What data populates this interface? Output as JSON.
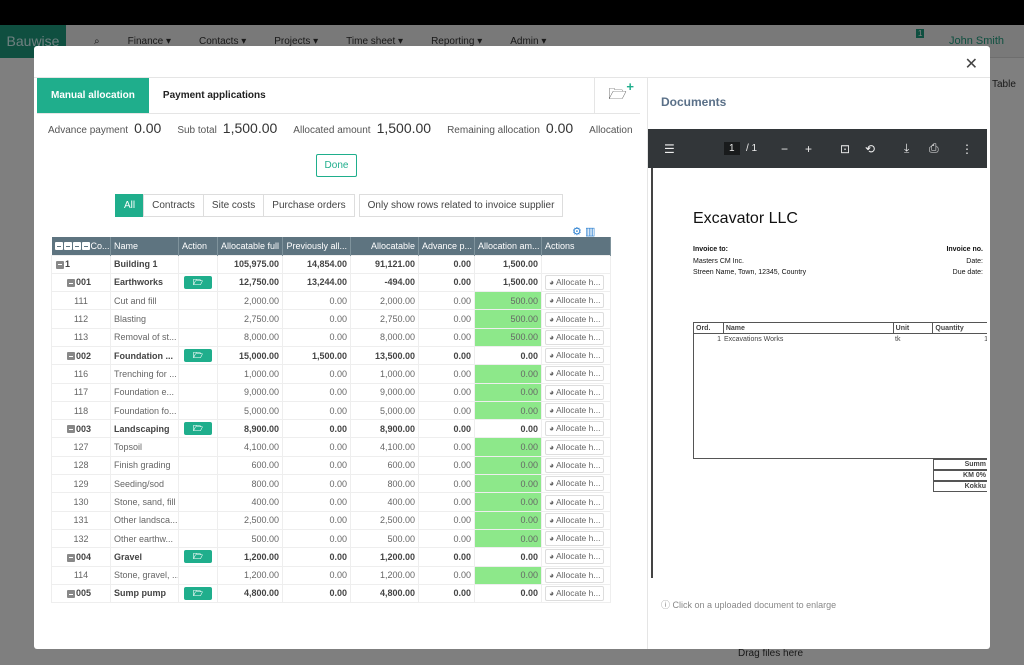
{
  "background": {
    "brand": "Bauwise",
    "nav": [
      "Finance ▾",
      "Contacts ▾",
      "Projects ▾",
      "Time sheet ▾",
      "Reporting ▾",
      "Admin ▾"
    ],
    "user": "John Smith",
    "notification_count": "1",
    "table_link": "Table",
    "drag_files": "Drag files here"
  },
  "modal": {
    "tabs": [
      "Manual allocation",
      "Payment applications"
    ],
    "summary": {
      "advance_label": "Advance payment",
      "advance": "0.00",
      "subtotal_label": "Sub total",
      "subtotal": "1,500.00",
      "allocated_label": "Allocated amount",
      "allocated": "1,500.00",
      "remaining_label": "Remaining allocation",
      "remaining": "0.00",
      "allocation_label": "Allocation"
    },
    "done": "Done",
    "filters": [
      "All",
      "Contracts",
      "Site costs",
      "Purchase orders"
    ],
    "supplier_filter": "Only show rows related to invoice supplier",
    "columns": [
      "Co...",
      "Name",
      "Action",
      "Allocatable full",
      "Previously all...",
      "Allocatable",
      "Advance p...",
      "Allocation am...",
      "Actions"
    ],
    "allocate_label": "Allocate h...",
    "rows": [
      {
        "code": "1",
        "name": "Building 1",
        "level": 0,
        "full": "105,975.00",
        "prev": "14,854.00",
        "alloc": "91,121.00",
        "adv": "0.00",
        "amt": "1,500.00"
      },
      {
        "code": "001",
        "name": "Earthworks",
        "level": 1,
        "full": "12,750.00",
        "prev": "13,244.00",
        "alloc": "-494.00",
        "adv": "0.00",
        "amt": "1,500.00"
      },
      {
        "code": "111",
        "name": "Cut and fill",
        "level": 2,
        "full": "2,000.00",
        "prev": "0.00",
        "alloc": "2,000.00",
        "adv": "0.00",
        "amt": "500.00"
      },
      {
        "code": "112",
        "name": "Blasting",
        "level": 2,
        "full": "2,750.00",
        "prev": "0.00",
        "alloc": "2,750.00",
        "adv": "0.00",
        "amt": "500.00"
      },
      {
        "code": "113",
        "name": "Removal of st...",
        "level": 2,
        "full": "8,000.00",
        "prev": "0.00",
        "alloc": "8,000.00",
        "adv": "0.00",
        "amt": "500.00"
      },
      {
        "code": "002",
        "name": "Foundation ...",
        "level": 1,
        "full": "15,000.00",
        "prev": "1,500.00",
        "alloc": "13,500.00",
        "adv": "0.00",
        "amt": "0.00"
      },
      {
        "code": "116",
        "name": "Trenching for ...",
        "level": 2,
        "full": "1,000.00",
        "prev": "0.00",
        "alloc": "1,000.00",
        "adv": "0.00",
        "amt": "0.00"
      },
      {
        "code": "117",
        "name": "Foundation e...",
        "level": 2,
        "full": "9,000.00",
        "prev": "0.00",
        "alloc": "9,000.00",
        "adv": "0.00",
        "amt": "0.00"
      },
      {
        "code": "118",
        "name": "Foundation fo...",
        "level": 2,
        "full": "5,000.00",
        "prev": "0.00",
        "alloc": "5,000.00",
        "adv": "0.00",
        "amt": "0.00"
      },
      {
        "code": "003",
        "name": "Landscaping",
        "level": 1,
        "full": "8,900.00",
        "prev": "0.00",
        "alloc": "8,900.00",
        "adv": "0.00",
        "amt": "0.00"
      },
      {
        "code": "127",
        "name": "Topsoil",
        "level": 2,
        "full": "4,100.00",
        "prev": "0.00",
        "alloc": "4,100.00",
        "adv": "0.00",
        "amt": "0.00"
      },
      {
        "code": "128",
        "name": "Finish grading",
        "level": 2,
        "full": "600.00",
        "prev": "0.00",
        "alloc": "600.00",
        "adv": "0.00",
        "amt": "0.00"
      },
      {
        "code": "129",
        "name": "Seeding/sod",
        "level": 2,
        "full": "800.00",
        "prev": "0.00",
        "alloc": "800.00",
        "adv": "0.00",
        "amt": "0.00"
      },
      {
        "code": "130",
        "name": "Stone, sand, fill",
        "level": 2,
        "full": "400.00",
        "prev": "0.00",
        "alloc": "400.00",
        "adv": "0.00",
        "amt": "0.00"
      },
      {
        "code": "131",
        "name": "Other landsca...",
        "level": 2,
        "full": "2,500.00",
        "prev": "0.00",
        "alloc": "2,500.00",
        "adv": "0.00",
        "amt": "0.00"
      },
      {
        "code": "132",
        "name": "Other earthw...",
        "level": 2,
        "full": "500.00",
        "prev": "0.00",
        "alloc": "500.00",
        "adv": "0.00",
        "amt": "0.00"
      },
      {
        "code": "004",
        "name": "Gravel",
        "level": 1,
        "full": "1,200.00",
        "prev": "0.00",
        "alloc": "1,200.00",
        "adv": "0.00",
        "amt": "0.00"
      },
      {
        "code": "114",
        "name": "Stone, gravel, ...",
        "level": 2,
        "full": "1,200.00",
        "prev": "0.00",
        "alloc": "1,200.00",
        "adv": "0.00",
        "amt": "0.00"
      },
      {
        "code": "005",
        "name": "Sump pump",
        "level": 1,
        "full": "4,800.00",
        "prev": "0.00",
        "alloc": "4,800.00",
        "adv": "0.00",
        "amt": "0.00"
      }
    ],
    "documents": {
      "title": "Documents",
      "page": "1",
      "pages": "/ 1",
      "info": "Click on a uploaded document to enlarge",
      "invoice": {
        "company": "Excavator LLC",
        "to_label": "Invoice to:",
        "to_name": "Masters CM Inc.",
        "to_address": "Streen Name, Town, 12345, Country",
        "no_label": "Invoice no.",
        "date_label": "Date:",
        "due_label": "Due date:",
        "columns": [
          "Ord.",
          "Name",
          "Unit",
          "Quantity"
        ],
        "line": {
          "ord": "1",
          "name": "Excavations Works",
          "unit": "tk",
          "qty": "1"
        },
        "totals": [
          "Summ",
          "KM 0%",
          "Kokku"
        ]
      }
    }
  },
  "colors": {
    "accent": "#1fae8c",
    "header": "#5e7480",
    "allocation_cell": "#8de88a",
    "pdf_toolbar": "#323639"
  }
}
